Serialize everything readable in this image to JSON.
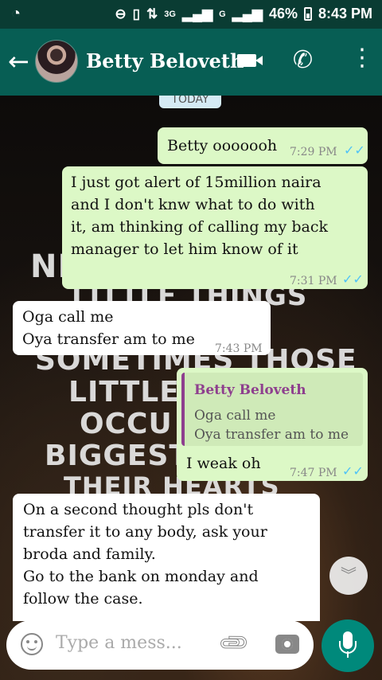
{
  "status_bar": {
    "network": "3G",
    "network2": "G",
    "battery": "46%",
    "time": "8:43 PM"
  },
  "header": {
    "contact_name": "Betty Beloveth",
    "back_icon": "back-arrow-icon",
    "video_icon": "video-call-icon",
    "phone_icon": "phone-icon",
    "menu_icon": "more-vert-icon"
  },
  "date_label": "TODAY",
  "wallpaper_text": [
    "NE",
    "LITTLE THINGS",
    "SOMETIMES THOSE",
    "LITTLE",
    "OCCU",
    "BIGGEST",
    "THEIR HEARTS"
  ],
  "messages": [
    {
      "dir": "out",
      "lines": [
        "Betty ooooooh"
      ],
      "time": "7:29 PM",
      "ticks": "✓✓"
    },
    {
      "dir": "out",
      "lines": [
        "I just got alert of 15million naira",
        "and I don't knw what to do with",
        "it, am thinking of calling my back",
        "manager to let him know of it"
      ],
      "time": "7:31 PM",
      "ticks": "✓✓"
    },
    {
      "dir": "in",
      "lines": [
        "Oga call me",
        "Oya transfer am to me"
      ],
      "time": "7:43 PM"
    },
    {
      "dir": "out",
      "quote": {
        "name": "Betty Beloveth",
        "lines": [
          "Oga call me",
          "Oya transfer am to me"
        ]
      },
      "lines": [
        "I weak oh"
      ],
      "time": "7:47 PM",
      "ticks": "✓✓"
    },
    {
      "dir": "in",
      "lines": [
        "On a second thought pls don't",
        "transfer it to any body,  ask your",
        "broda and family.",
        "Go to the bank on monday and",
        "follow the case."
      ]
    }
  ],
  "input": {
    "placeholder": "Type a mess...",
    "emoji_icon": "emoji-icon",
    "attach_icon": "paperclip-icon",
    "camera_icon": "camera-icon",
    "mic_icon": "mic-icon"
  },
  "colors": {
    "status_bar": "#0a3c33",
    "app_bar": "#075e54",
    "outgoing_bubble": "#dcf8c6",
    "incoming_bubble": "#ffffff",
    "read_tick": "#4fc3f7",
    "quote_accent": "#8e3f8e",
    "mic_button": "#00897b"
  }
}
